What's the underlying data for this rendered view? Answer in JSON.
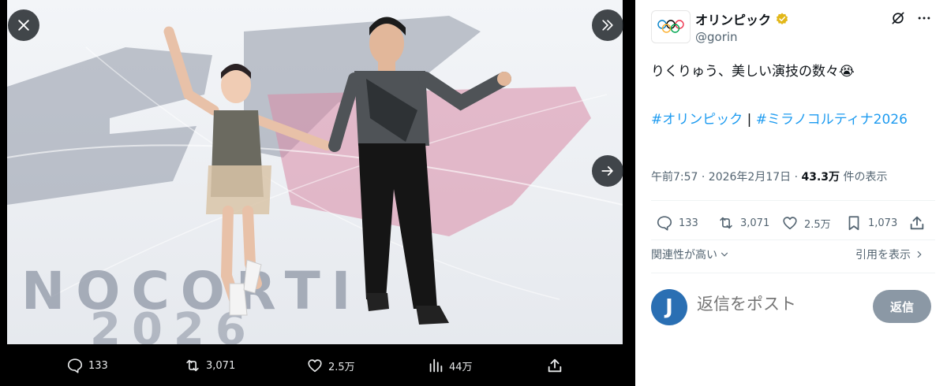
{
  "media": {
    "rink_text": "NOCORTI",
    "rink_year": "2026",
    "actions": {
      "reply_count": "133",
      "retweet_count": "3,071",
      "like_count": "2.5万",
      "view_count": "44万"
    }
  },
  "tweet": {
    "author_name": "オリンピック",
    "author_handle": "@gorin",
    "text": "りくりゅう、美しい演技の数々😭",
    "hashtag_1": "#オリンピック",
    "separator": "|",
    "hashtag_2": "#ミラノコルティナ2026",
    "time": "午前7:57 · 2026年2月17日 · ",
    "views": "43.3万",
    "views_suffix": " 件の表示",
    "actions": {
      "reply_count": "133",
      "retweet_count": "3,071",
      "like_count": "2.5万",
      "bookmark_count": "1,073"
    },
    "related_label": "関連性が高い",
    "quotes_label": "引用を表示",
    "reply_avatar_letter": "J",
    "reply_placeholder": "返信をポスト",
    "reply_button": "返信"
  },
  "colors": {
    "accent": "#1d9bf0",
    "verified_gold": "#e2b719",
    "reply_button_disabled": "#8b98a5"
  }
}
